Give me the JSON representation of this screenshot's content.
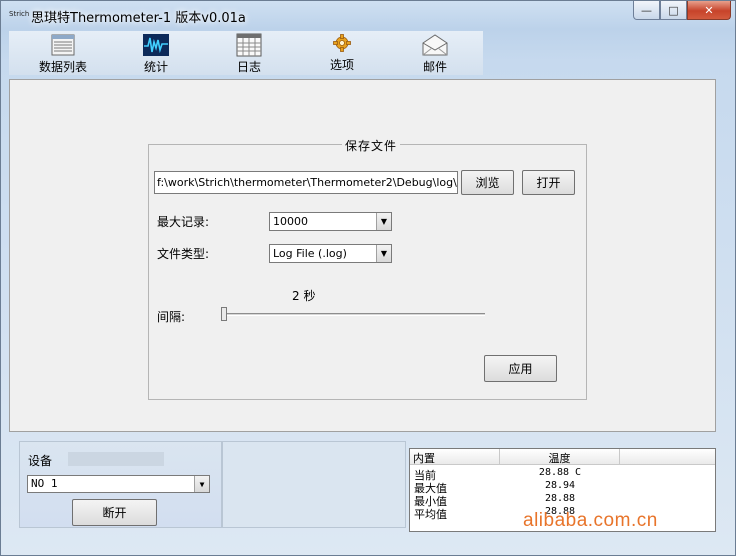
{
  "window": {
    "app_icon_text": "Strich",
    "title": "思琪特Thermometer-1 版本v0.01a",
    "controls": {
      "minimize": "—",
      "maximize": "□",
      "close": "✕"
    }
  },
  "toolbar": {
    "items": [
      {
        "label": "数据列表",
        "icon": "data-list-icon"
      },
      {
        "label": "统计",
        "icon": "statistics-icon"
      },
      {
        "label": "日志",
        "icon": "log-icon"
      },
      {
        "label": "选项",
        "icon": "options-icon"
      },
      {
        "label": "邮件",
        "icon": "mail-icon"
      }
    ]
  },
  "save_file": {
    "group_title": "保存文件",
    "path_value": "f:\\work\\Strich\\thermometer\\Thermometer2\\Debug\\log\\",
    "browse_label": "浏览",
    "open_label": "打开",
    "max_records_label": "最大记录:",
    "max_records_value": "10000",
    "file_type_label": "文件类型:",
    "file_type_value": "Log File (.log)",
    "interval_value_text": "2 秒",
    "interval_label": "间隔:",
    "interval_level": 0,
    "apply_label": "应用"
  },
  "device": {
    "label": "设备",
    "selected": "NO 1",
    "disconnect_label": "断开"
  },
  "readings": {
    "headers": [
      "内置",
      "温度"
    ],
    "rows": [
      {
        "name": "当前",
        "value": "28.88 C"
      },
      {
        "name": "最大值",
        "value": "28.94"
      },
      {
        "name": "最小值",
        "value": "28.88"
      },
      {
        "name": "平均值",
        "value": "28.88"
      }
    ]
  },
  "watermark": "alibaba.com.cn",
  "colors": {
    "window_bg": "#bcd2ea",
    "panel_bg": "#f0f0f0",
    "close_button": "#c7432a",
    "watermark": "#e8742a"
  }
}
